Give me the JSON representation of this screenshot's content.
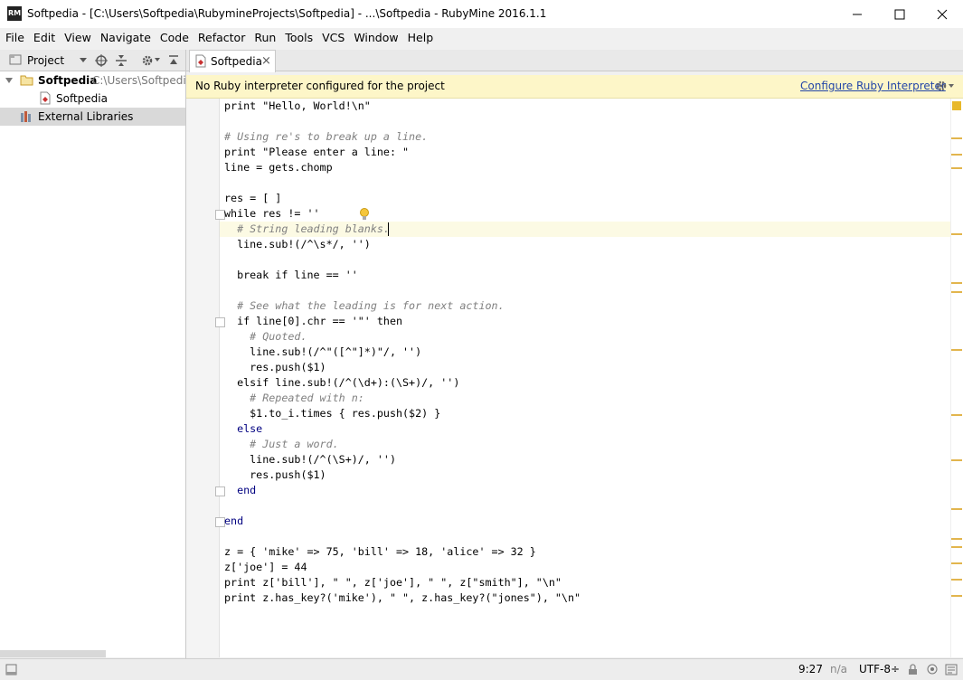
{
  "window": {
    "title": "Softpedia - [C:\\Users\\Softpedia\\RubymineProjects\\Softpedia] - ...\\Softpedia - RubyMine 2016.1.1",
    "app_icon_text": "RM",
    "minimize": "—",
    "maximize": "☐",
    "close": "✕"
  },
  "menu": [
    "File",
    "Edit",
    "View",
    "Navigate",
    "Code",
    "Refactor",
    "Run",
    "Tools",
    "VCS",
    "Window",
    "Help"
  ],
  "project_panel": {
    "title": "Project",
    "root_name": "Softpedia",
    "root_path": "C:\\Users\\Softpedia\\",
    "child": "Softpedia",
    "libraries": "External Libraries"
  },
  "editor_tab": {
    "label": "Softpedia",
    "close": "×"
  },
  "banner": {
    "message": "No Ruby interpreter configured for the project",
    "link": "Configure Ruby Interpreter"
  },
  "code": [
    "print \"Hello, World!\\n\"",
    "",
    "# Using re's to break up a line.",
    "print \"Please enter a line: \"",
    "line = gets.chomp",
    "",
    "res = [ ]",
    "while res != ''",
    "  # String leading blanks.",
    "  line.sub!(/^\\s*/, '')",
    "",
    "  break if line == ''",
    "",
    "  # See what the leading is for next action.",
    "  if line[0].chr == '\"' then",
    "    # Quoted.",
    "    line.sub!(/^\"([^\"]*)\"/, '')",
    "    res.push($1)",
    "  elsif line.sub!(/^(\\d+):(\\S+)/, '')",
    "    # Repeated with n:",
    "    $1.to_i.times { res.push($2) }",
    "  else",
    "    # Just a word.",
    "    line.sub!(/^(\\S+)/, '')",
    "    res.push($1)",
    "  end",
    "",
    "end",
    "",
    "z = { 'mike' => 75, 'bill' => 18, 'alice' => 32 }",
    "z['joe'] = 44",
    "print z['bill'], \" \", z['joe'], \" \", z[\"smith\"], \"\\n\"",
    "print z.has_key?('mike'), \" \", z.has_key?(\"jones\"), \"\\n\""
  ],
  "status": {
    "position": "9:27",
    "na": "n/a",
    "encoding": "UTF-8÷"
  },
  "colors": {
    "banner_bg": "#fdf6c8",
    "accent_link": "#2346a8",
    "selected_row": "#d9d9d9"
  }
}
